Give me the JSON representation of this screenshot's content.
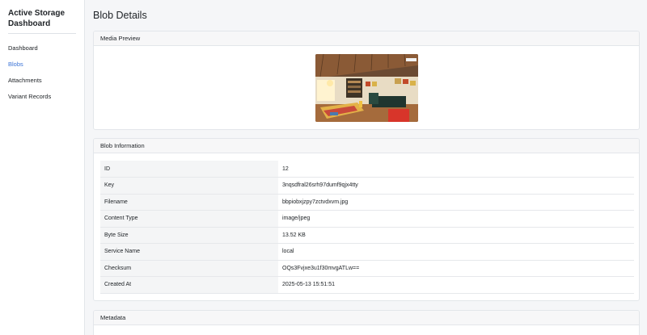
{
  "sidebar": {
    "brand": "Active Storage Dashboard",
    "items": [
      {
        "label": "Dashboard",
        "active": false
      },
      {
        "label": "Blobs",
        "active": true
      },
      {
        "label": "Attachments",
        "active": false
      },
      {
        "label": "Variant Records",
        "active": false
      }
    ]
  },
  "main": {
    "title": "Blob Details",
    "preview": {
      "header": "Media Preview"
    },
    "info": {
      "header": "Blob Information",
      "rows": [
        {
          "key": "ID",
          "value": "12"
        },
        {
          "key": "Key",
          "value": "3nqsdfral26srh97dumf9qjx4tty"
        },
        {
          "key": "Filename",
          "value": "bbpiobxjzpy7zctvdxvm.jpg"
        },
        {
          "key": "Content Type",
          "value": "image/jpeg"
        },
        {
          "key": "Byte Size",
          "value": "13.52 KB"
        },
        {
          "key": "Service Name",
          "value": "local"
        },
        {
          "key": "Checksum",
          "value": "OQs3Fvjxe3u1f30mvgATLw=="
        },
        {
          "key": "Created At",
          "value": "2025-05-13 15:51:51"
        }
      ]
    },
    "metadata": {
      "header": "Metadata"
    }
  },
  "colors": {
    "accent": "#3b73d6",
    "background": "#f5f6f8"
  }
}
